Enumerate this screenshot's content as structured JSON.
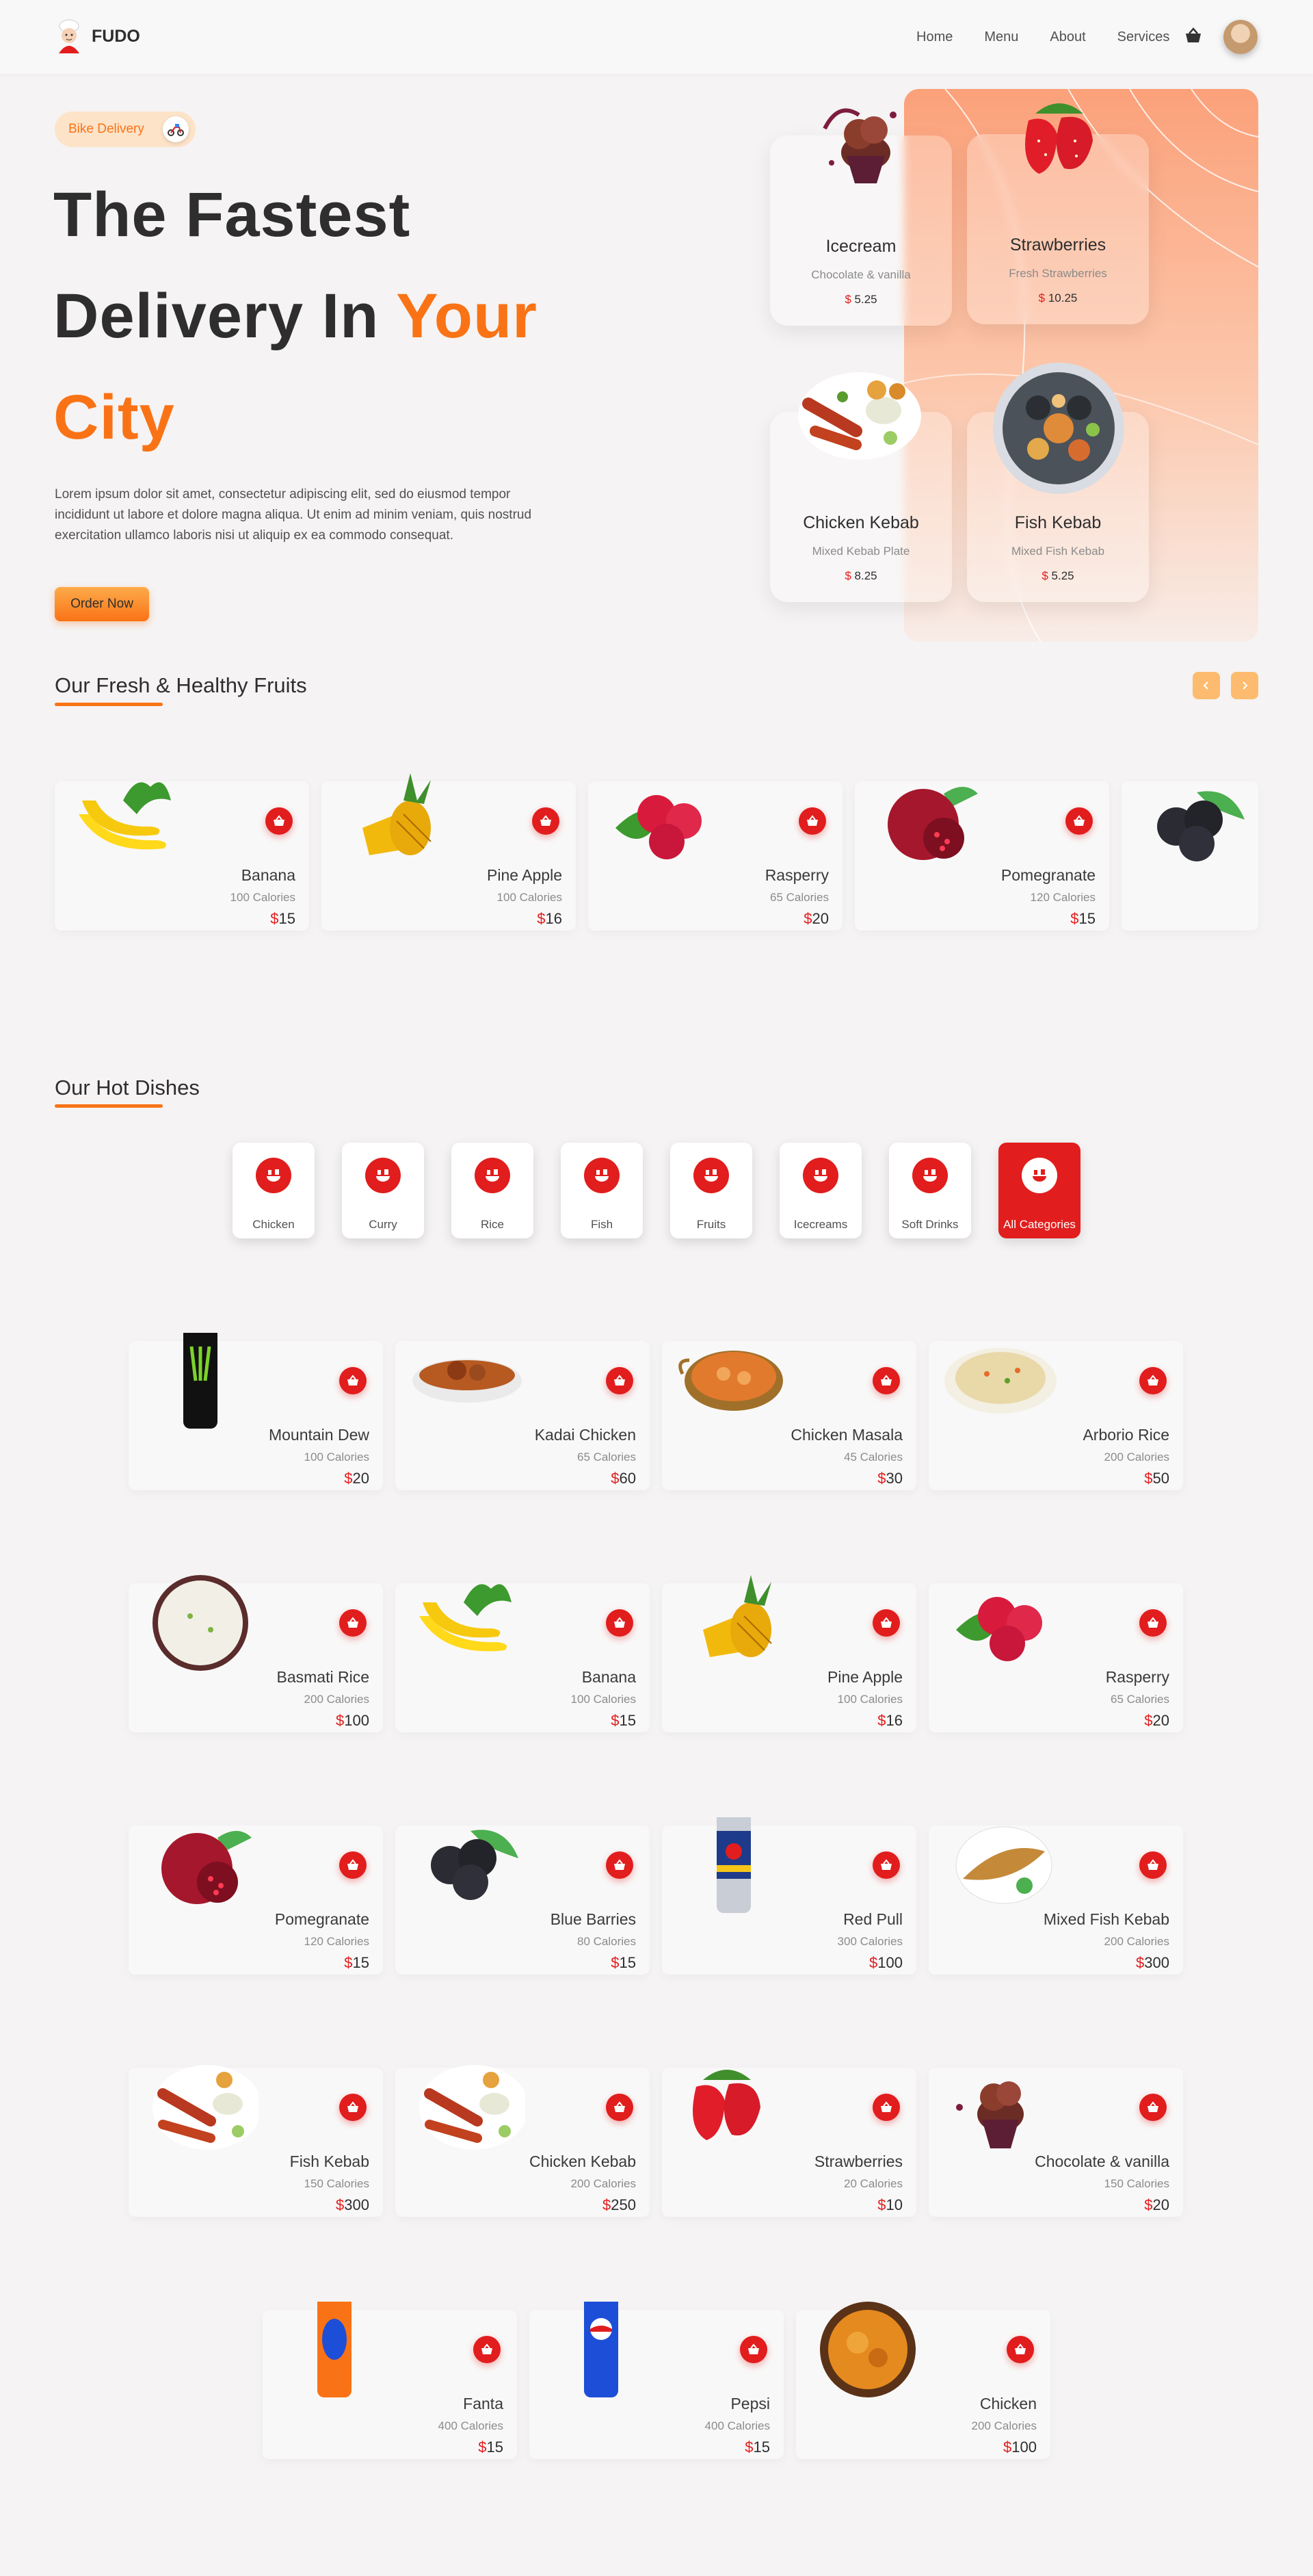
{
  "header": {
    "brand": "FUDO",
    "nav": [
      "Home",
      "Menu",
      "About",
      "Services"
    ]
  },
  "hero": {
    "pill_label": "Bike Delivery",
    "title_line1": "The Fastest",
    "title_line2": "Delivery In ",
    "title_accent1": "Your",
    "title_accent2": "City",
    "description": "Lorem ipsum dolor sit amet, consectetur adipiscing elit, sed do eiusmod tempor incididunt ut labore et dolore magna aliqua. Ut enim ad minim veniam, quis nostrud exercitation ullamco laboris nisi ut aliquip ex ea commodo consequat.",
    "cta": "Order Now",
    "cards": [
      {
        "name": "Icecream",
        "sub": "Chocolate & vanilla",
        "currency": "$",
        "price": "5.25"
      },
      {
        "name": "Strawberries",
        "sub": "Fresh Strawberries",
        "currency": "$",
        "price": "10.25"
      },
      {
        "name": "Chicken Kebab",
        "sub": "Mixed Kebab Plate",
        "currency": "$",
        "price": "8.25"
      },
      {
        "name": "Fish Kebab",
        "sub": "Mixed Fish Kebab",
        "currency": "$",
        "price": "5.25"
      }
    ]
  },
  "fruits": {
    "title": "Our Fresh & Healthy Fruits",
    "items": [
      {
        "name": "Banana",
        "calories": "100 Calories",
        "currency": "$",
        "price": "15",
        "icon": "banana"
      },
      {
        "name": "Pine Apple",
        "calories": "100 Calories",
        "currency": "$",
        "price": "16",
        "icon": "pineapple"
      },
      {
        "name": "Rasperry",
        "calories": "65 Calories",
        "currency": "$",
        "price": "20",
        "icon": "raspberry"
      },
      {
        "name": "Pomegranate",
        "calories": "120 Calories",
        "currency": "$",
        "price": "15",
        "icon": "pomegranate"
      }
    ]
  },
  "hot": {
    "title": "Our Hot Dishes",
    "categories": [
      "Chicken",
      "Curry",
      "Rice",
      "Fish",
      "Fruits",
      "Icecreams",
      "Soft Drinks",
      "All Categories"
    ],
    "items": [
      {
        "name": "Mountain Dew",
        "calories": "100 Calories",
        "currency": "$",
        "price": "20",
        "icon": "can-monster"
      },
      {
        "name": "Kadai Chicken",
        "calories": "65 Calories",
        "currency": "$",
        "price": "60",
        "icon": "curry-bowl"
      },
      {
        "name": "Chicken Masala",
        "calories": "45 Calories",
        "currency": "$",
        "price": "30",
        "icon": "masala-pot"
      },
      {
        "name": "Arborio Rice",
        "calories": "200 Calories",
        "currency": "$",
        "price": "50",
        "icon": "rice-plate"
      },
      {
        "name": "Basmati Rice",
        "calories": "200 Calories",
        "currency": "$",
        "price": "100",
        "icon": "rice-bowl"
      },
      {
        "name": "Banana",
        "calories": "100 Calories",
        "currency": "$",
        "price": "15",
        "icon": "banana"
      },
      {
        "name": "Pine Apple",
        "calories": "100 Calories",
        "currency": "$",
        "price": "16",
        "icon": "pineapple"
      },
      {
        "name": "Rasperry",
        "calories": "65 Calories",
        "currency": "$",
        "price": "20",
        "icon": "raspberry"
      },
      {
        "name": "Pomegranate",
        "calories": "120 Calories",
        "currency": "$",
        "price": "15",
        "icon": "pomegranate"
      },
      {
        "name": "Blue Barries",
        "calories": "80 Calories",
        "currency": "$",
        "price": "15",
        "icon": "blackberry"
      },
      {
        "name": "Red Pull",
        "calories": "300 Calories",
        "currency": "$",
        "price": "100",
        "icon": "can-redbull"
      },
      {
        "name": "Mixed Fish Kebab",
        "calories": "200 Calories",
        "currency": "$",
        "price": "300",
        "icon": "fish-plate"
      },
      {
        "name": "Fish Kebab",
        "calories": "150 Calories",
        "currency": "$",
        "price": "300",
        "icon": "kebab-plate"
      },
      {
        "name": "Chicken Kebab",
        "calories": "200 Calories",
        "currency": "$",
        "price": "250",
        "icon": "kebab-plate"
      },
      {
        "name": "Strawberries",
        "calories": "20 Calories",
        "currency": "$",
        "price": "10",
        "icon": "strawberry"
      },
      {
        "name": "Chocolate & vanilla",
        "calories": "150 Calories",
        "currency": "$",
        "price": "20",
        "icon": "icecream"
      },
      {
        "name": "Fanta",
        "calories": "400 Calories",
        "currency": "$",
        "price": "15",
        "icon": "can-fanta"
      },
      {
        "name": "Pepsi",
        "calories": "400 Calories",
        "currency": "$",
        "price": "15",
        "icon": "can-pepsi"
      },
      {
        "name": "Chicken",
        "calories": "200 Calories",
        "currency": "$",
        "price": "100",
        "icon": "chicken-bowl"
      }
    ]
  },
  "colors": {
    "accent": "#f97316",
    "red": "#e11d1d",
    "bg": "#f5f3f3"
  }
}
